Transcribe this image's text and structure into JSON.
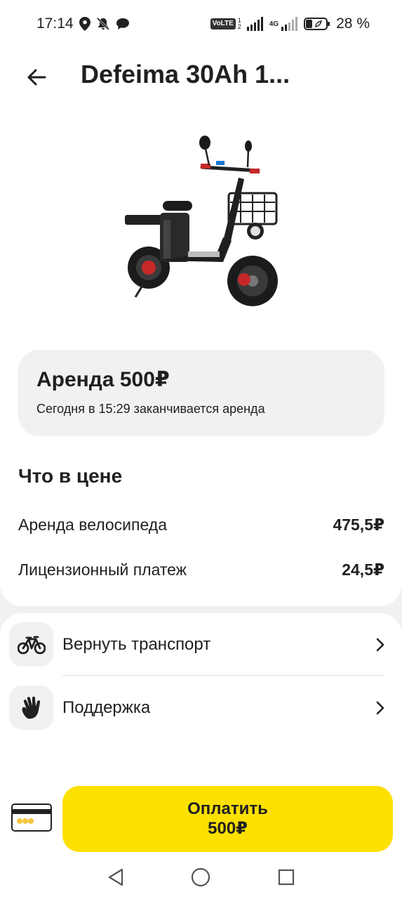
{
  "status_bar": {
    "time": "17:14",
    "volte": "VoLTE",
    "sim_numbers": [
      "1",
      "2"
    ],
    "network": "4G",
    "battery": "28 %"
  },
  "header": {
    "title": "Defeima 30Ah 1..."
  },
  "rent": {
    "title": "Аренда 500₽",
    "subtitle": "Сегодня в 15:29 заканчивается аренда"
  },
  "price": {
    "title": "Что в цене",
    "rows": [
      {
        "label": "Аренда велосипеда",
        "value": "475,5₽"
      },
      {
        "label": "Лицензионный платеж",
        "value": "24,5₽"
      }
    ]
  },
  "actions": [
    {
      "label": "Вернуть транспорт",
      "icon": "bicycle-icon"
    },
    {
      "label": "Поддержка",
      "icon": "hand-icon"
    }
  ],
  "pay": {
    "label": "Оплатить",
    "amount": "500₽",
    "color": "#fce000"
  },
  "colors": {
    "background": "#f2f1ef",
    "text": "#21201f",
    "accent": "#fce000"
  }
}
